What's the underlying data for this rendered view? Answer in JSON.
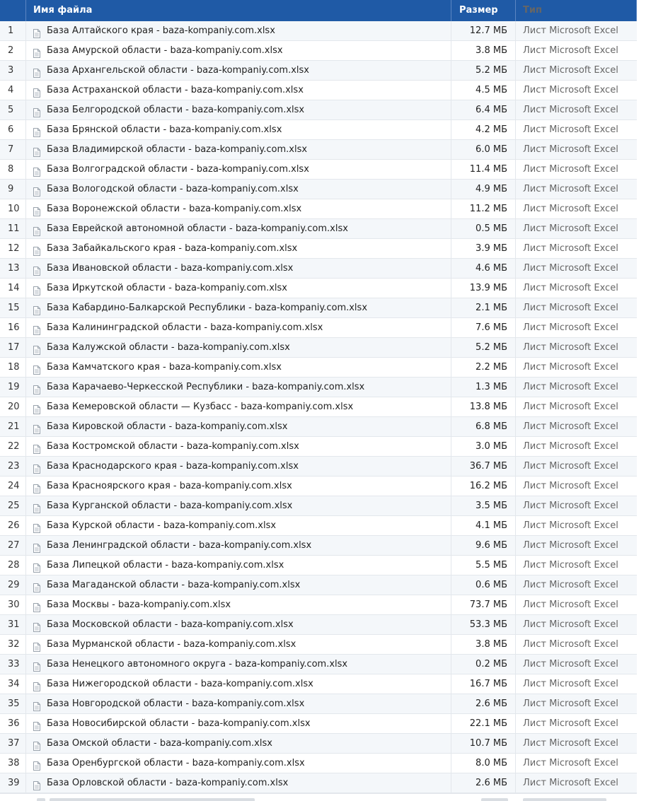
{
  "columns": {
    "name": "Имя файла",
    "size": "Размер",
    "type": "Тип"
  },
  "icon": "file-icon",
  "rows": [
    {
      "n": "1",
      "name": "База Алтайского края - baza-kompaniy.com.xlsx",
      "size": "12.7 МБ",
      "type": "Лист Microsoft Excel"
    },
    {
      "n": "2",
      "name": "База Амурской области - baza-kompaniy.com.xlsx",
      "size": "3.8 МБ",
      "type": "Лист Microsoft Excel"
    },
    {
      "n": "3",
      "name": "База Архангельской области - baza-kompaniy.com.xlsx",
      "size": "5.2 МБ",
      "type": "Лист Microsoft Excel"
    },
    {
      "n": "4",
      "name": "База Астраханской области - baza-kompaniy.com.xlsx",
      "size": "4.5 МБ",
      "type": "Лист Microsoft Excel"
    },
    {
      "n": "5",
      "name": "База Белгородской области - baza-kompaniy.com.xlsx",
      "size": "6.4 МБ",
      "type": "Лист Microsoft Excel"
    },
    {
      "n": "6",
      "name": "База Брянской области - baza-kompaniy.com.xlsx",
      "size": "4.2 МБ",
      "type": "Лист Microsoft Excel"
    },
    {
      "n": "7",
      "name": "База Владимирской области - baza-kompaniy.com.xlsx",
      "size": "6.0 МБ",
      "type": "Лист Microsoft Excel"
    },
    {
      "n": "8",
      "name": "База Волгоградской области - baza-kompaniy.com.xlsx",
      "size": "11.4 МБ",
      "type": "Лист Microsoft Excel"
    },
    {
      "n": "9",
      "name": "База Вологодской области - baza-kompaniy.com.xlsx",
      "size": "4.9 МБ",
      "type": "Лист Microsoft Excel"
    },
    {
      "n": "10",
      "name": "База Воронежской области - baza-kompaniy.com.xlsx",
      "size": "11.2 МБ",
      "type": "Лист Microsoft Excel"
    },
    {
      "n": "11",
      "name": "База Еврейской автономной области - baza-kompaniy.com.xlsx",
      "size": "0.5 МБ",
      "type": "Лист Microsoft Excel"
    },
    {
      "n": "12",
      "name": "База Забайкальского края - baza-kompaniy.com.xlsx",
      "size": "3.9 МБ",
      "type": "Лист Microsoft Excel"
    },
    {
      "n": "13",
      "name": "База Ивановской области - baza-kompaniy.com.xlsx",
      "size": "4.6 МБ",
      "type": "Лист Microsoft Excel"
    },
    {
      "n": "14",
      "name": "База Иркутской области - baza-kompaniy.com.xlsx",
      "size": "13.9 МБ",
      "type": "Лист Microsoft Excel"
    },
    {
      "n": "15",
      "name": "База Кабардино-Балкарской Республики - baza-kompaniy.com.xlsx",
      "size": "2.1 МБ",
      "type": "Лист Microsoft Excel"
    },
    {
      "n": "16",
      "name": "База Калининградской области - baza-kompaniy.com.xlsx",
      "size": "7.6 МБ",
      "type": "Лист Microsoft Excel"
    },
    {
      "n": "17",
      "name": "База Калужской области - baza-kompaniy.com.xlsx",
      "size": "5.2 МБ",
      "type": "Лист Microsoft Excel"
    },
    {
      "n": "18",
      "name": "База Камчатского края - baza-kompaniy.com.xlsx",
      "size": "2.2 МБ",
      "type": "Лист Microsoft Excel"
    },
    {
      "n": "19",
      "name": "База Карачаево-Черкесской Республики - baza-kompaniy.com.xlsx",
      "size": "1.3 МБ",
      "type": "Лист Microsoft Excel"
    },
    {
      "n": "20",
      "name": "База Кемеровской области — Кузбасс - baza-kompaniy.com.xlsx",
      "size": "13.8 МБ",
      "type": "Лист Microsoft Excel"
    },
    {
      "n": "21",
      "name": "База Кировской области - baza-kompaniy.com.xlsx",
      "size": "6.8 МБ",
      "type": "Лист Microsoft Excel"
    },
    {
      "n": "22",
      "name": "База Костромской области - baza-kompaniy.com.xlsx",
      "size": "3.0 МБ",
      "type": "Лист Microsoft Excel"
    },
    {
      "n": "23",
      "name": "База Краснодарского края - baza-kompaniy.com.xlsx",
      "size": "36.7 МБ",
      "type": "Лист Microsoft Excel"
    },
    {
      "n": "24",
      "name": "База Красноярского края - baza-kompaniy.com.xlsx",
      "size": "16.2 МБ",
      "type": "Лист Microsoft Excel"
    },
    {
      "n": "25",
      "name": "База Курганской области - baza-kompaniy.com.xlsx",
      "size": "3.5 МБ",
      "type": "Лист Microsoft Excel"
    },
    {
      "n": "26",
      "name": "База Курской области - baza-kompaniy.com.xlsx",
      "size": "4.1 МБ",
      "type": "Лист Microsoft Excel"
    },
    {
      "n": "27",
      "name": "База Ленинградской области - baza-kompaniy.com.xlsx",
      "size": "9.6 МБ",
      "type": "Лист Microsoft Excel"
    },
    {
      "n": "28",
      "name": "База Липецкой области - baza-kompaniy.com.xlsx",
      "size": "5.5 МБ",
      "type": "Лист Microsoft Excel"
    },
    {
      "n": "29",
      "name": "База Магаданской области - baza-kompaniy.com.xlsx",
      "size": "0.6 МБ",
      "type": "Лист Microsoft Excel"
    },
    {
      "n": "30",
      "name": "База Москвы - baza-kompaniy.com.xlsx",
      "size": "73.7 МБ",
      "type": "Лист Microsoft Excel"
    },
    {
      "n": "31",
      "name": "База Московской области - baza-kompaniy.com.xlsx",
      "size": "53.3 МБ",
      "type": "Лист Microsoft Excel"
    },
    {
      "n": "32",
      "name": "База Мурманской области - baza-kompaniy.com.xlsx",
      "size": "3.8 МБ",
      "type": "Лист Microsoft Excel"
    },
    {
      "n": "33",
      "name": "База Ненецкого автономного округа - baza-kompaniy.com.xlsx",
      "size": "0.2 МБ",
      "type": "Лист Microsoft Excel"
    },
    {
      "n": "34",
      "name": "База Нижегородской области - baza-kompaniy.com.xlsx",
      "size": "16.7 МБ",
      "type": "Лист Microsoft Excel"
    },
    {
      "n": "35",
      "name": "База Новгородской области - baza-kompaniy.com.xlsx",
      "size": "2.6 МБ",
      "type": "Лист Microsoft Excel"
    },
    {
      "n": "36",
      "name": "База Новосибирской области - baza-kompaniy.com.xlsx",
      "size": "22.1 МБ",
      "type": "Лист Microsoft Excel"
    },
    {
      "n": "37",
      "name": "База Омской области - baza-kompaniy.com.xlsx",
      "size": "10.7 МБ",
      "type": "Лист Microsoft Excel"
    },
    {
      "n": "38",
      "name": "База Оренбургской области - baza-kompaniy.com.xlsx",
      "size": "8.0 МБ",
      "type": "Лист Microsoft Excel"
    },
    {
      "n": "39",
      "name": "База Орловской области - baza-kompaniy.com.xlsx",
      "size": "2.6 МБ",
      "type": "Лист Microsoft Excel"
    }
  ],
  "colors": {
    "header_bg": "#1f5aa6",
    "header_text": "#ffffff",
    "row_alt_bg": "#f4f7fa",
    "grid_line": "#e3e7ec",
    "type_text": "#666666"
  }
}
